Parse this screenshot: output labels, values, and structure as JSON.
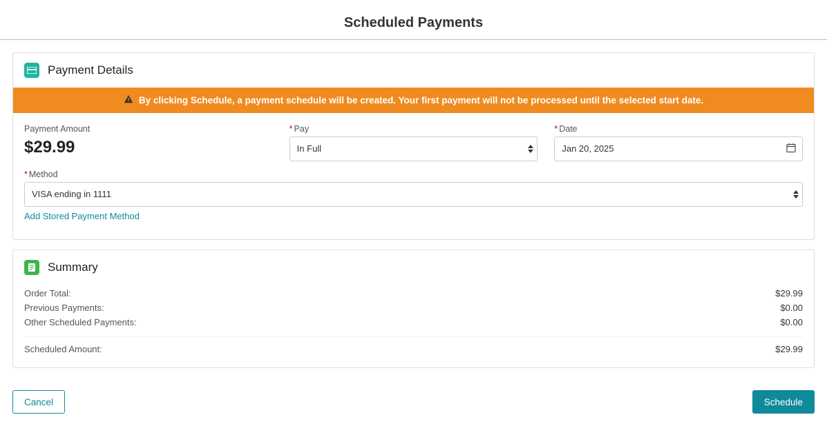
{
  "page": {
    "title": "Scheduled Payments"
  },
  "details": {
    "panel_title": "Payment Details",
    "banner_text": "By clicking Schedule, a payment schedule will be created. Your first payment will not be processed until the selected start date.",
    "amount_label": "Payment Amount",
    "amount_value": "$29.99",
    "pay_label": "Pay",
    "pay_value": "In Full",
    "date_label": "Date",
    "date_value": "Jan 20, 2025",
    "method_label": "Method",
    "method_value": "VISA ending in 1111",
    "add_method_link": "Add Stored Payment Method"
  },
  "summary": {
    "panel_title": "Summary",
    "rows": {
      "order_total": {
        "label": "Order Total:",
        "value": "$29.99"
      },
      "previous": {
        "label": "Previous Payments:",
        "value": "$0.00"
      },
      "other": {
        "label": "Other Scheduled Payments:",
        "value": "$0.00"
      },
      "scheduled": {
        "label": "Scheduled Amount:",
        "value": "$29.99"
      }
    }
  },
  "footer": {
    "cancel": "Cancel",
    "schedule": "Schedule"
  }
}
